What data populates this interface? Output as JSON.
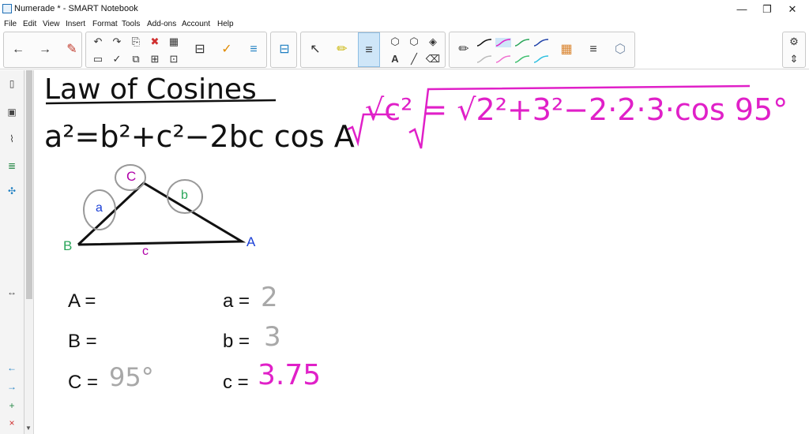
{
  "window": {
    "title": "Numerade * - SMART Notebook",
    "controls": {
      "minimize": "—",
      "restore": "❐",
      "close": "✕"
    }
  },
  "menu": [
    "File",
    "Edit",
    "View",
    "Insert",
    "Format",
    "Tools",
    "Add-ons",
    "Account",
    "Help"
  ],
  "colors": {
    "pen_black": "#111111",
    "pen_magenta": "#e020c8",
    "pen_gray": "#a8a8a8",
    "label_green": "#2aa65a",
    "label_blue": "#1a3fd6",
    "label_purple": "#b000a8",
    "toolbar_selected": "#cfe6f8"
  },
  "toolbar": {
    "nav": {
      "back_icon": "←",
      "forward_icon": "→",
      "pen_icon": "✎"
    },
    "edit_icons": [
      "↶",
      "↷",
      "⎘",
      "✖",
      "▦",
      "▭",
      "✓",
      "⧉",
      "⊞",
      "⊡",
      "⊟",
      "≡"
    ],
    "tools": {
      "select": "↖",
      "pen": "✏",
      "text": "A",
      "line": "╱",
      "eraser": "⌫",
      "shape": "⬡",
      "fill": "◈"
    },
    "settings_icon": "⚙",
    "expand_icon": "⇕"
  },
  "sidebar_icons": [
    "page-sorter-icon",
    "gallery-icon",
    "attachments-icon",
    "properties-icon",
    "addons-icon"
  ],
  "sidebar_bottom": {
    "collapse": "↔",
    "prev": "←",
    "next": "→",
    "add_page": "+",
    "delete_page": "×"
  },
  "notes": {
    "heading": "Law of Cosines",
    "formula": "a²=b²+c²−2bc cos A",
    "substitution": "√c² = √2²+3²−2·2·3·cos 95°",
    "triangle": {
      "vertex_b": "B",
      "vertex_a": "A",
      "vertex_c": "C",
      "side_a": "a",
      "side_b": "b",
      "side_c": "c"
    },
    "rows": [
      {
        "label": "A =",
        "value": ""
      },
      {
        "label": "B =",
        "value": ""
      },
      {
        "label": "C =",
        "value": "95°"
      }
    ],
    "sides": [
      {
        "label": "a =",
        "value": "2"
      },
      {
        "label": "b =",
        "value": "3"
      },
      {
        "label": "c =",
        "value": "3.75"
      }
    ]
  }
}
